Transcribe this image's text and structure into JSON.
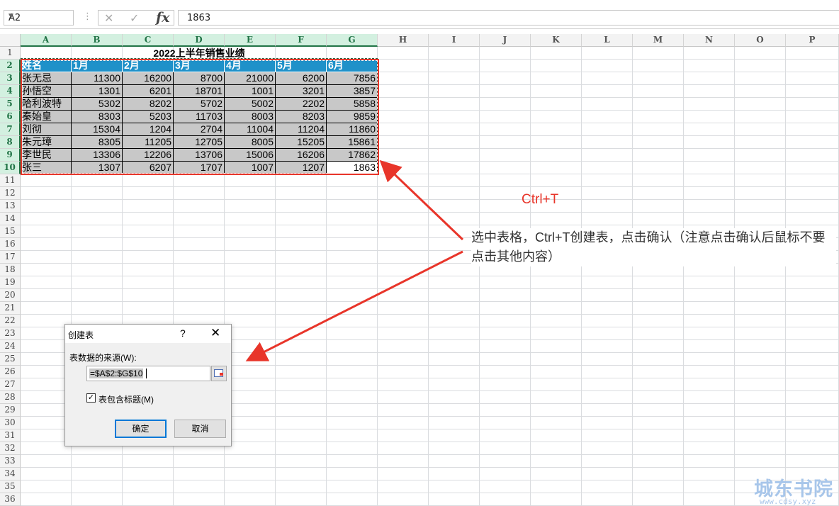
{
  "formula_bar": {
    "name_box": "A2",
    "cancel_icon": "✕",
    "enter_icon": "✓",
    "fx_label": "fx",
    "content": "1863"
  },
  "columns": [
    "A",
    "B",
    "C",
    "D",
    "E",
    "F",
    "G",
    "H",
    "I",
    "J",
    "K",
    "L",
    "M",
    "N",
    "O",
    "P"
  ],
  "rows": [
    "1",
    "2",
    "3",
    "4",
    "5",
    "6",
    "7",
    "8",
    "9",
    "10",
    "11",
    "12",
    "13",
    "14",
    "15",
    "16",
    "17",
    "18",
    "19",
    "20",
    "21",
    "22",
    "23",
    "24",
    "25",
    "26",
    "27",
    "28",
    "29",
    "30",
    "31",
    "32",
    "33",
    "34",
    "35",
    "36"
  ],
  "sheet": {
    "title": "2022上半年销售业绩",
    "headers": [
      "姓名",
      "1月",
      "2月",
      "3月",
      "4月",
      "5月",
      "6月"
    ],
    "data": [
      [
        "张无忌",
        "11300",
        "16200",
        "8700",
        "21000",
        "6200",
        "7856"
      ],
      [
        "孙悟空",
        "1301",
        "6201",
        "18701",
        "1001",
        "3201",
        "3857"
      ],
      [
        "哈利波特",
        "5302",
        "8202",
        "5702",
        "5002",
        "2202",
        "5858"
      ],
      [
        "秦始皇",
        "8303",
        "5203",
        "11703",
        "8003",
        "8203",
        "9859"
      ],
      [
        "刘彻",
        "15304",
        "1204",
        "2704",
        "11004",
        "11204",
        "11860"
      ],
      [
        "朱元璋",
        "8305",
        "11205",
        "12705",
        "8005",
        "15205",
        "15861"
      ],
      [
        "李世民",
        "13306",
        "12206",
        "13706",
        "15006",
        "16206",
        "17862"
      ],
      [
        "张三",
        "1307",
        "6207",
        "1707",
        "1007",
        "1207",
        "1863"
      ]
    ]
  },
  "annotation": {
    "shortcut": "Ctrl+T",
    "text": "选中表格，Ctrl+T创建表，点击确认（注意点击确认后鼠标不要点击其他内容）",
    "arrow_color": "#e8352a"
  },
  "dialog": {
    "title": "创建表",
    "help": "?",
    "close": "✕",
    "source_label": "表数据的来源(W):",
    "source_value": "=$A$2:$G$10",
    "has_headers_label": "表包含标题(M)",
    "has_headers_checked": "✓",
    "ok": "确定",
    "cancel": "取消"
  },
  "watermark": {
    "text": "城东书院",
    "sub": "www.cdsy.xyz"
  }
}
